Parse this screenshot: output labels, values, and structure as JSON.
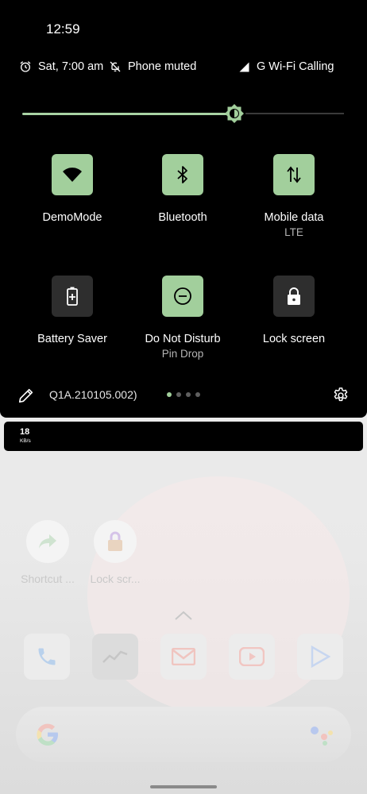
{
  "status_bar": {
    "time": "12:59"
  },
  "info_bar": {
    "alarm": "Sat, 7:00 am",
    "ringer": "Phone muted",
    "network": "G Wi-Fi Calling"
  },
  "brightness": {
    "level": 0.66
  },
  "tiles": [
    {
      "label": "DemoMode",
      "sub": "",
      "icon": "wifi-icon",
      "active": true
    },
    {
      "label": "Bluetooth",
      "sub": "",
      "icon": "bluetooth-icon",
      "active": true
    },
    {
      "label": "Mobile data",
      "sub": "LTE",
      "icon": "mobile-data-arrows-icon",
      "active": true
    },
    {
      "label": "Battery Saver",
      "sub": "",
      "icon": "battery-saver-icon",
      "active": false
    },
    {
      "label": "Do Not Disturb",
      "sub": "Pin Drop",
      "icon": "do-not-disturb-icon",
      "active": true
    },
    {
      "label": "Lock screen",
      "sub": "",
      "icon": "lock-icon",
      "active": false
    }
  ],
  "footer": {
    "build": "Q1A.210105.002)",
    "pages": 4,
    "active_page": 0
  },
  "network_speed": {
    "value": "18",
    "unit": "KB/s"
  },
  "home": {
    "shortcuts": [
      {
        "label": "Shortcut ..."
      },
      {
        "label": "Lock scr..."
      }
    ]
  },
  "colors": {
    "accent": "#a2cf9c",
    "tile_off": "#2e2e2e",
    "shade": "#000000"
  }
}
